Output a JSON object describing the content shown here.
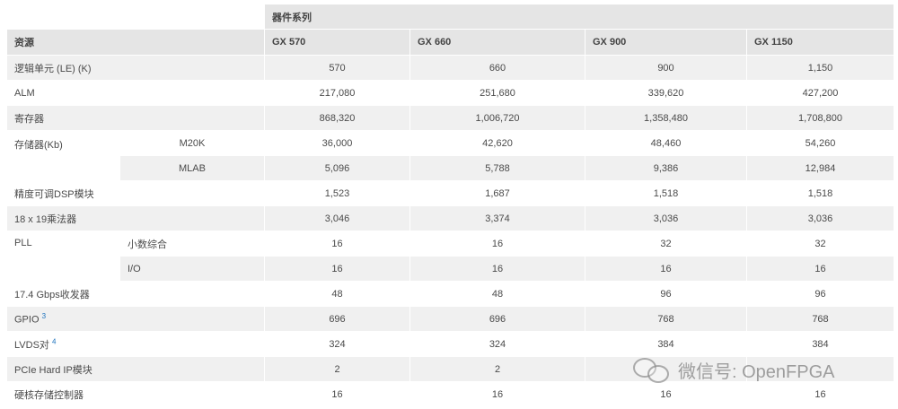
{
  "header": {
    "family_label": "器件系列",
    "resource_label": "资源",
    "columns": [
      "GX 570",
      "GX 660",
      "GX 900",
      "GX 1150"
    ]
  },
  "rows": {
    "le": {
      "label": "逻辑单元 (LE) (K)",
      "values": [
        "570",
        "660",
        "900",
        "1,150"
      ]
    },
    "alm": {
      "label": "ALM",
      "values": [
        "217,080",
        "251,680",
        "339,620",
        "427,200"
      ]
    },
    "reg": {
      "label": "寄存器",
      "values": [
        "868,320",
        "1,006,720",
        "1,358,480",
        "1,708,800"
      ]
    },
    "mem": {
      "label": "存储器(Kb)",
      "m20k": {
        "label": "M20K",
        "values": [
          "36,000",
          "42,620",
          "48,460",
          "54,260"
        ]
      },
      "mlab": {
        "label": "MLAB",
        "values": [
          "5,096",
          "5,788",
          "9,386",
          "12,984"
        ]
      }
    },
    "dsp": {
      "label": "精度可调DSP模块",
      "values": [
        "1,523",
        "1,687",
        "1,518",
        "1,518"
      ]
    },
    "mult": {
      "label": "18 x 19乘法器",
      "values": [
        "3,046",
        "3,374",
        "3,036",
        "3,036"
      ]
    },
    "pll": {
      "label": "PLL",
      "frac": {
        "label": "小数综合",
        "values": [
          "16",
          "16",
          "32",
          "32"
        ]
      },
      "io": {
        "label": "I/O",
        "values": [
          "16",
          "16",
          "16",
          "16"
        ]
      }
    },
    "xcvr": {
      "label": "17.4 Gbps收发器",
      "values": [
        "48",
        "48",
        "96",
        "96"
      ]
    },
    "gpio": {
      "label": "GPIO",
      "sup": "3",
      "values": [
        "696",
        "696",
        "768",
        "768"
      ]
    },
    "lvds": {
      "label": "LVDS对",
      "sup": "4",
      "values": [
        "324",
        "324",
        "384",
        "384"
      ]
    },
    "pcie": {
      "label": "PCIe Hard IP模块",
      "values": [
        "2",
        "2",
        "",
        ""
      ]
    },
    "hmc": {
      "label": "硬核存储控制器",
      "values": [
        "16",
        "16",
        "16",
        "16"
      ]
    }
  },
  "watermark": {
    "text": "微信号: OpenFPGA",
    "icon": "wechat-icon"
  }
}
